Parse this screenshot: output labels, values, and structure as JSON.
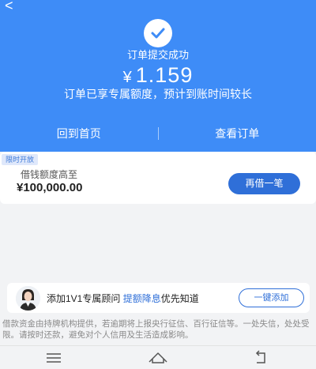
{
  "header": {
    "back_icon": "chevron-left-icon",
    "status_icon": "check-circle-icon",
    "status_title": "订单提交成功",
    "amount_currency": "¥",
    "amount_value": "1.159",
    "subtitle": "订单已享专属额度，预计到账时间较长",
    "background_color": "#3e8cf7"
  },
  "actions": {
    "home_label": "回到首页",
    "orders_label": "查看订单"
  },
  "credit_card": {
    "badge": "限时开放",
    "limit_label": "借钱额度高至",
    "limit_amount": "¥100,000.00",
    "borrow_button": "再借一笔",
    "accent_color": "#2f6fd8"
  },
  "advisor": {
    "avatar_icon": "advisor-avatar-icon",
    "text_prefix": "添加1V1专属顾问",
    "text_highlight": "提额降息",
    "text_suffix": "优先知道",
    "add_button": "一键添加"
  },
  "disclaimer": "借款资金由持牌机构提供，若逾期将上报央行征信、百行征信等。一处失信，处处受限。请按时还款，避免对个人信用及生活造成影响。",
  "system_nav": {
    "menu_icon": "menu-icon",
    "home_icon": "home-icon",
    "back_icon": "back-icon"
  }
}
